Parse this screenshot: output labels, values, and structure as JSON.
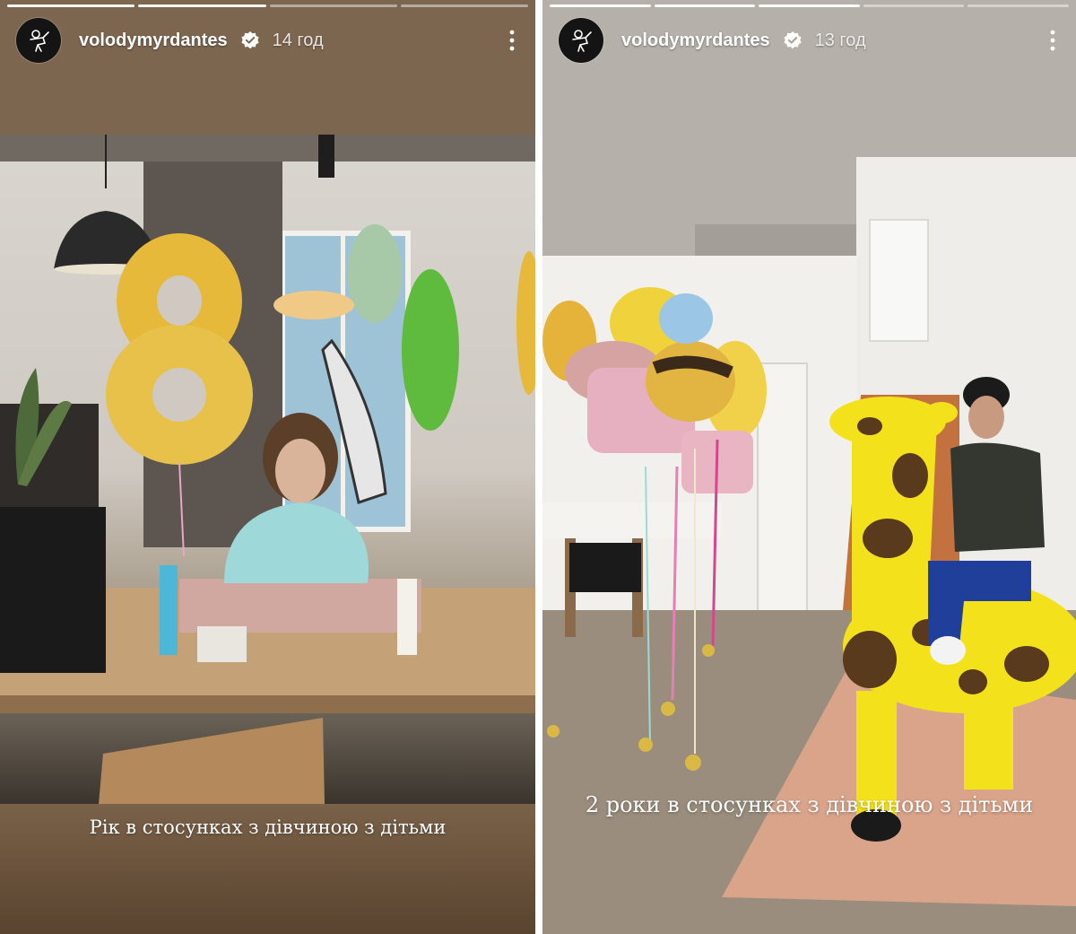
{
  "stories": [
    {
      "username": "volodymyrdantes",
      "time": "14 год",
      "progress_segments": 4,
      "progress_active": 1,
      "caption": "Рік в стосунках з дівчиною з дітьми",
      "icons": {
        "avatar": "avatar-logo-icon",
        "verified": "verified-badge-icon",
        "more": "more-options-icon"
      }
    },
    {
      "username": "volodymyrdantes",
      "time": "13 год",
      "progress_segments": 5,
      "progress_active": 2,
      "caption": "2 роки в стосунках з дівчиною з дітьми",
      "icons": {
        "avatar": "avatar-logo-icon",
        "verified": "verified-badge-icon",
        "more": "more-options-icon"
      }
    }
  ],
  "colors": {
    "left_background": "#7d6650",
    "balloon_gold": "#e6b93a",
    "giraffe_yellow": "#f3e21b",
    "giraffe_spot": "#5a3a1c"
  }
}
